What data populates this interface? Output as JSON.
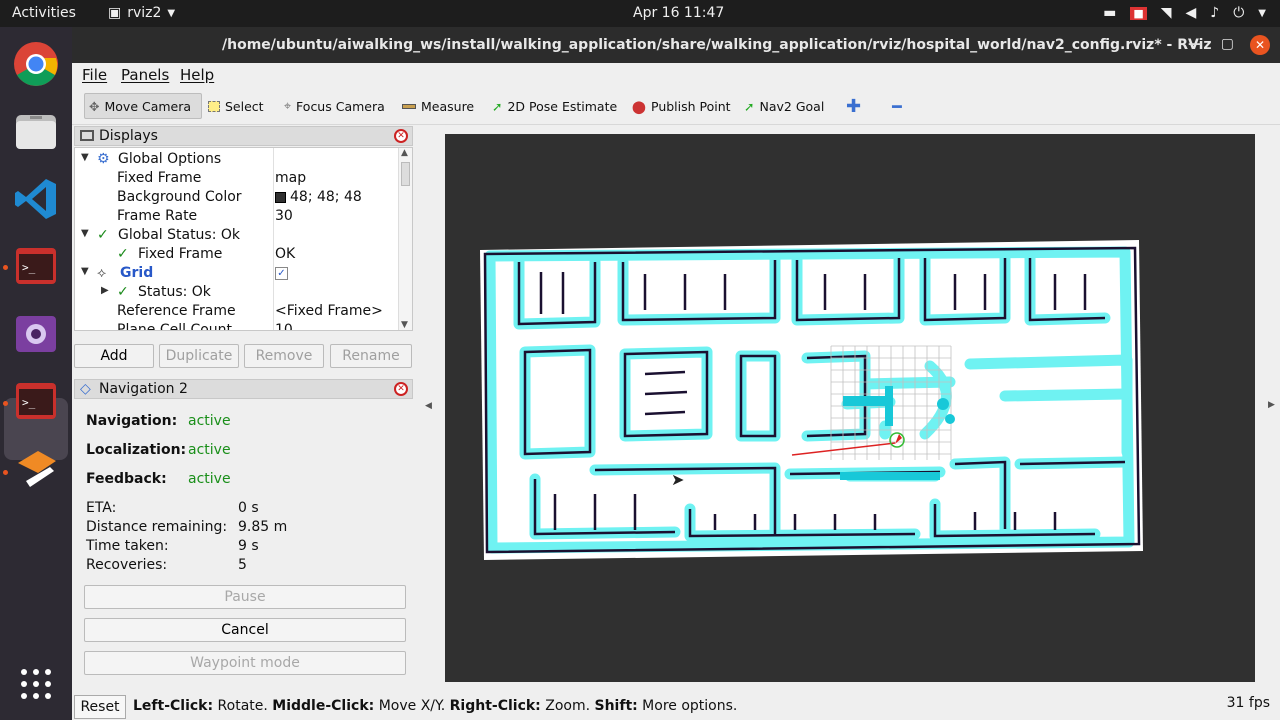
{
  "topbar": {
    "activities": "Activities",
    "app_name": "rviz2",
    "clock": "Apr 16  11:47"
  },
  "dock": {
    "items": [
      "chrome-icon",
      "files-icon",
      "vscode-icon",
      "terminal-icon",
      "camera-icon",
      "terminal-icon",
      "layers-icon",
      "app-grid-icon"
    ]
  },
  "window": {
    "title": "/home/ubuntu/aiwalking_ws/install/walking_application/share/walking_application/rviz/hospital_world/nav2_config.rviz* - RViz"
  },
  "menubar": [
    "File",
    "Panels",
    "Help"
  ],
  "toolbar": {
    "move_camera": "Move Camera",
    "select": "Select",
    "focus_camera": "Focus Camera",
    "measure": "Measure",
    "pose_estimate": "2D Pose Estimate",
    "publish_point": "Publish Point",
    "nav2_goal": "Nav2 Goal"
  },
  "displays": {
    "title": "Displays",
    "rows": {
      "global_options": "Global Options",
      "fixed_frame_k": "Fixed Frame",
      "fixed_frame_v": "map",
      "bg_color_k": "Background Color",
      "bg_color_v": "48; 48; 48",
      "frame_rate_k": "Frame Rate",
      "frame_rate_v": "30",
      "global_status": "Global Status: Ok",
      "gs_fixed_frame_k": "Fixed Frame",
      "gs_fixed_frame_v": "OK",
      "grid": "Grid",
      "status_ok": "Status: Ok",
      "ref_frame_k": "Reference Frame",
      "ref_frame_v": "<Fixed Frame>",
      "plane_cell_k": "Plane Cell Count",
      "plane_cell_v": "10"
    },
    "buttons": {
      "add": "Add",
      "duplicate": "Duplicate",
      "remove": "Remove",
      "rename": "Rename"
    }
  },
  "navigation": {
    "title": "Navigation 2",
    "navigation_k": "Navigation:",
    "navigation_v": "active",
    "localization_k": "Localization:",
    "localization_v": "active",
    "feedback_k": "Feedback:",
    "feedback_v": "active",
    "eta_k": "ETA:",
    "eta_v": "0 s",
    "distance_k": "Distance remaining:",
    "distance_v": "9.85 m",
    "time_k": "Time taken:",
    "time_v": "9 s",
    "recoveries_k": "Recoveries:",
    "recoveries_v": "5",
    "pause": "Pause",
    "cancel": "Cancel",
    "waypoint": "Waypoint mode"
  },
  "statusbar": {
    "reset": "Reset",
    "left_click": "Left-Click:",
    "rotate": " Rotate. ",
    "middle_click": "Middle-Click:",
    "move": " Move X/Y. ",
    "right_click": "Right-Click:",
    "zoom": " Zoom. ",
    "shift": "Shift:",
    "more": " More options.",
    "fps": "31 fps"
  },
  "colors": {
    "viewport_bg": "#303030",
    "costmap": "#6ff2f2",
    "walls": "#1a1030",
    "accent": "#e95420"
  }
}
